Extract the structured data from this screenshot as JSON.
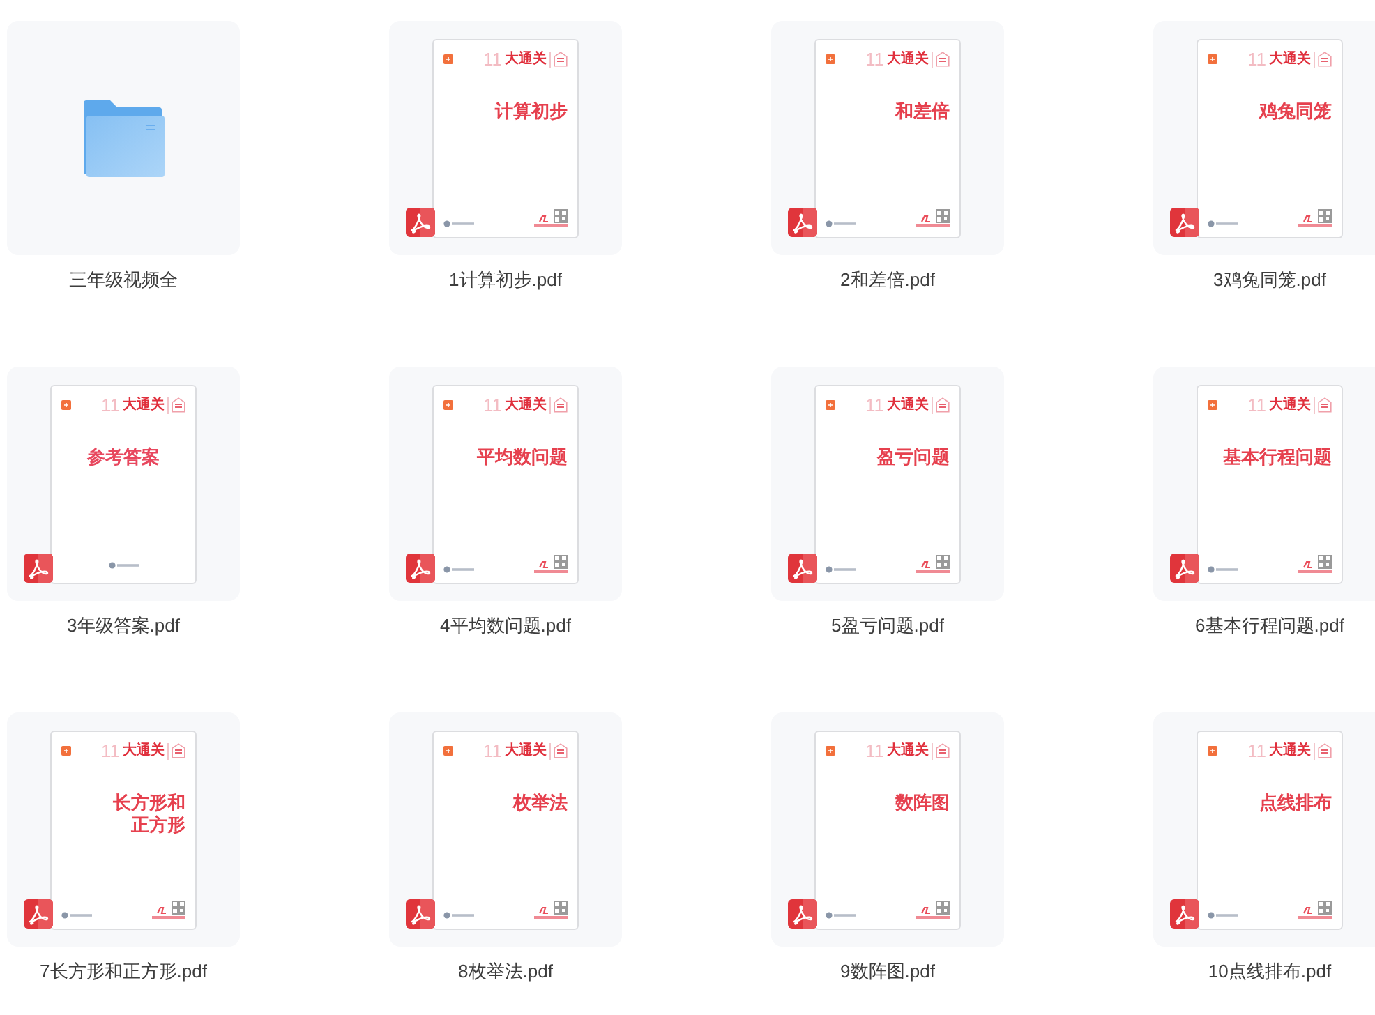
{
  "files": [
    {
      "kind": "folder",
      "name": "三年级视频全"
    },
    {
      "kind": "pdf",
      "name": "1计算初步.pdf",
      "cover": {
        "kind": "lesson",
        "brand_number": "11",
        "brand": "大通关",
        "title_lines": [
          "计算初步"
        ]
      }
    },
    {
      "kind": "pdf",
      "name": "2和差倍.pdf",
      "cover": {
        "kind": "lesson",
        "brand_number": "11",
        "brand": "大通关",
        "title_lines": [
          "和差倍"
        ]
      }
    },
    {
      "kind": "pdf",
      "name": "3鸡兔同笼.pdf",
      "cover": {
        "kind": "lesson",
        "brand_number": "11",
        "brand": "大通关",
        "title_lines": [
          "鸡兔同笼"
        ]
      }
    },
    {
      "kind": "pdf",
      "name": "3年级答案.pdf",
      "cover": {
        "kind": "answer",
        "brand_number": "11",
        "brand": "大通关",
        "title_lines": [
          "参考答案"
        ]
      }
    },
    {
      "kind": "pdf",
      "name": "4平均数问题.pdf",
      "cover": {
        "kind": "lesson",
        "brand_number": "11",
        "brand": "大通关",
        "title_lines": [
          "平均数问题"
        ]
      }
    },
    {
      "kind": "pdf",
      "name": "5盈亏问题.pdf",
      "cover": {
        "kind": "lesson",
        "brand_number": "11",
        "brand": "大通关",
        "title_lines": [
          "盈亏问题"
        ]
      }
    },
    {
      "kind": "pdf",
      "name": "6基本行程问题.pdf",
      "cover": {
        "kind": "lesson",
        "brand_number": "11",
        "brand": "大通关",
        "title_lines": [
          "基本行程问题"
        ]
      }
    },
    {
      "kind": "pdf",
      "name": "7长方形和正方形.pdf",
      "cover": {
        "kind": "lesson",
        "brand_number": "11",
        "brand": "大通关",
        "title_lines": [
          "长方形和",
          "正方形"
        ]
      }
    },
    {
      "kind": "pdf",
      "name": "8枚举法.pdf",
      "cover": {
        "kind": "lesson",
        "brand_number": "11",
        "brand": "大通关",
        "title_lines": [
          "枚举法"
        ]
      }
    },
    {
      "kind": "pdf",
      "name": "9数阵图.pdf",
      "cover": {
        "kind": "lesson",
        "brand_number": "11",
        "brand": "大通关",
        "title_lines": [
          "数阵图"
        ]
      }
    },
    {
      "kind": "pdf",
      "name": "10点线排布.pdf",
      "cover": {
        "kind": "lesson",
        "brand_number": "11",
        "brand": "大通关",
        "title_lines": [
          "点线排布"
        ]
      }
    }
  ]
}
